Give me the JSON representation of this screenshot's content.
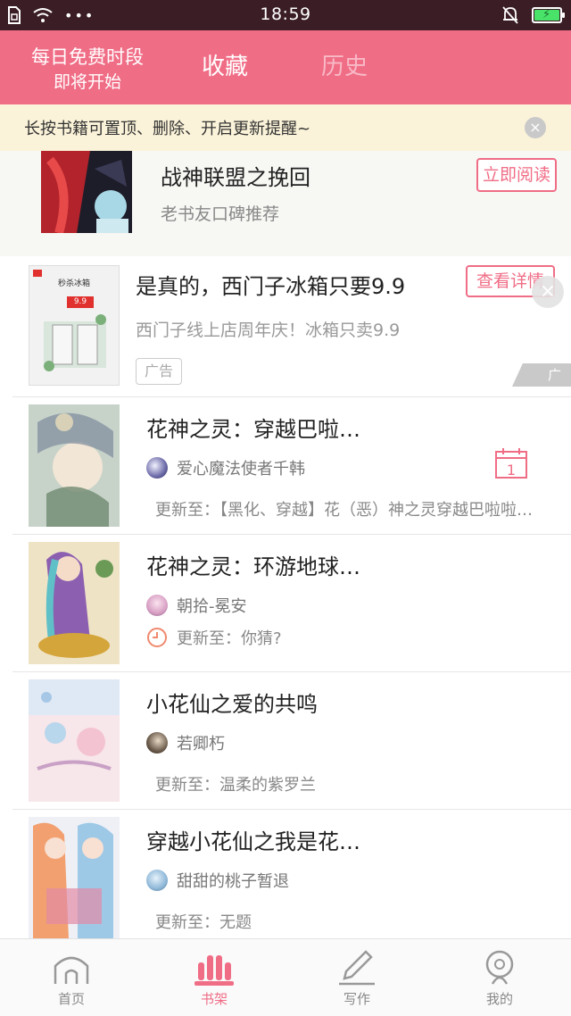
{
  "status_bar": {
    "time": "18:59",
    "signal_dots": "•••",
    "icons": [
      "sim-icon",
      "wifi-icon",
      "mute-bell-icon",
      "battery-charging-icon"
    ]
  },
  "header": {
    "promo_line1": "每日免费时段",
    "promo_line2": "即将开始",
    "tab_favorites": "收藏",
    "tab_history": "历史"
  },
  "tip": {
    "text": "长按书籍可置顶、删除、开启更新提醒~",
    "close": "×"
  },
  "featured": {
    "title": "战神联盟之挽回",
    "subtitle": "老书友口碑推荐",
    "button": "立即阅读"
  },
  "ad": {
    "title": "是真的，西门子冰箱只要9.9",
    "subtitle": "西门子线上店周年庆！冰箱只卖9.9",
    "tag": "广告",
    "button": "查看详情",
    "corner_tag": "广告",
    "close": "×",
    "cover_line1": "秒杀冰箱",
    "cover_price": "9.9"
  },
  "books": [
    {
      "title": "花神之灵：穿越巴啦…",
      "author": "爱心魔法使者千韩",
      "update": "更新至：【黑化、穿越】花（恶）神之灵穿越巴啦啦小魔仙",
      "calendar_day": "1"
    },
    {
      "title": "花神之灵：环游地球…",
      "author": "朝拾-冕安",
      "update": "更新至：你猜?"
    },
    {
      "title": "小花仙之爱的共鸣",
      "author": "若卿朽",
      "update": "更新至：温柔的紫罗兰"
    },
    {
      "title": "穿越小花仙之我是花…",
      "author": "甜甜的桃子暂退",
      "update": "更新至：无题"
    }
  ],
  "nav": {
    "home": "首页",
    "shelf": "书架",
    "write": "写作",
    "me": "我的"
  },
  "colors": {
    "accent": "#f06d86",
    "status_bar": "#3a1d25",
    "tip_bg": "#fbf3d9"
  }
}
